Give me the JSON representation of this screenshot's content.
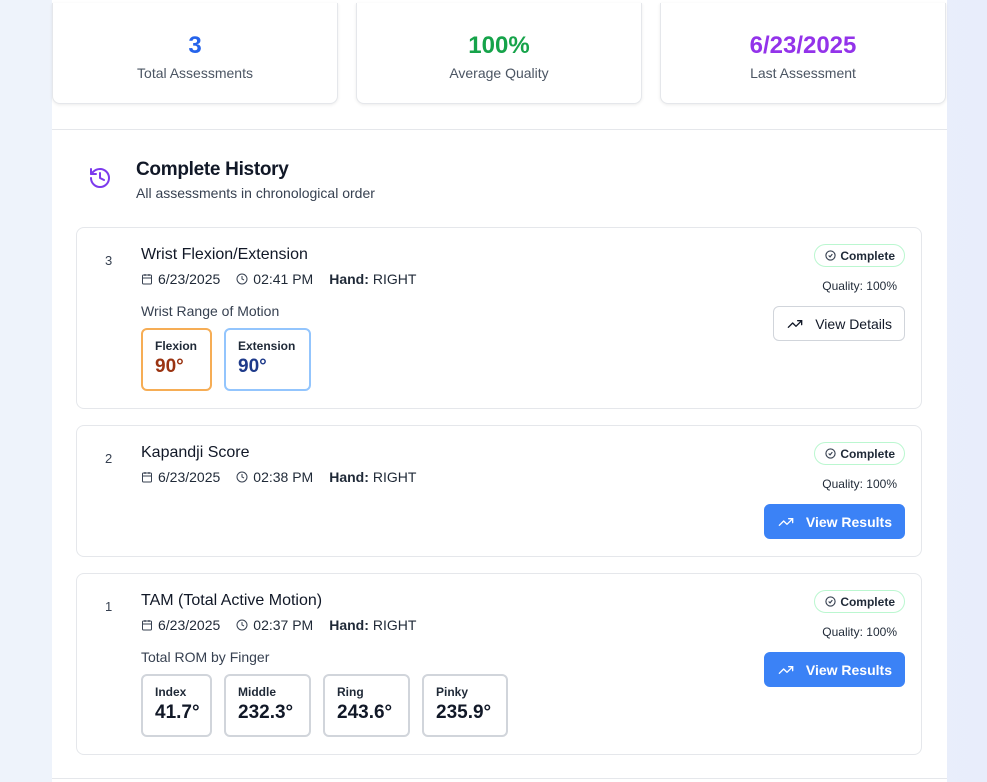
{
  "stats": [
    {
      "value": "3",
      "label": "Total Assessments",
      "color": "#2563eb"
    },
    {
      "value": "100%",
      "label": "Average Quality",
      "color": "#16a34a"
    },
    {
      "value": "6/23/2025",
      "label": "Last Assessment",
      "color": "#9333ea"
    }
  ],
  "history": {
    "icon": "history-icon",
    "title": "Complete History",
    "subtitle": "All assessments in chronological order"
  },
  "assessments": [
    {
      "number": "3",
      "title": "Wrist Flexion/Extension",
      "date": "6/23/2025",
      "time": "02:41 PM",
      "hand_label": "Hand:",
      "hand": "RIGHT",
      "status": "Complete",
      "quality": "Quality: 100%",
      "button": "View Details",
      "section_label": "Wrist Range of Motion",
      "values": [
        {
          "label": "Flexion",
          "value": "90°"
        },
        {
          "label": "Extension",
          "value": "90°"
        }
      ]
    },
    {
      "number": "2",
      "title": "Kapandji Score",
      "date": "6/23/2025",
      "time": "02:38 PM",
      "hand_label": "Hand:",
      "hand": "RIGHT",
      "status": "Complete",
      "quality": "Quality: 100%",
      "button": "View Results"
    },
    {
      "number": "1",
      "title": "TAM (Total Active Motion)",
      "date": "6/23/2025",
      "time": "02:37 PM",
      "hand_label": "Hand:",
      "hand": "RIGHT",
      "status": "Complete",
      "quality": "Quality: 100%",
      "button": "View Results",
      "section_label": "Total ROM by Finger",
      "values": [
        {
          "label": "Index",
          "value": "41.7°"
        },
        {
          "label": "Middle",
          "value": "232.3°"
        },
        {
          "label": "Ring",
          "value": "243.6°"
        },
        {
          "label": "Pinky",
          "value": "235.9°"
        }
      ]
    }
  ],
  "colors": {
    "primary": "#3b82f6",
    "flexion_border": "#f6ad55",
    "extension_border": "#93c5fd",
    "badge_border": "#bbf7d0",
    "history_icon": "#7c3aed"
  }
}
